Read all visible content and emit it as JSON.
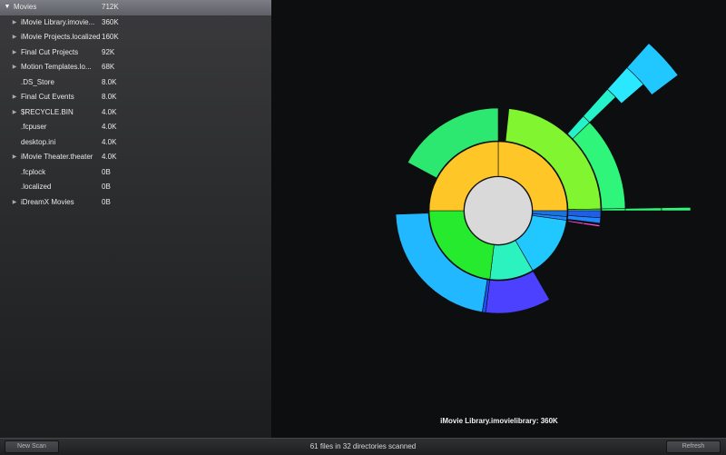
{
  "sidebar": {
    "items": [
      {
        "name": "Movies",
        "size": "712K",
        "expander": "down"
      },
      {
        "name": "iMovie Library.imovie...",
        "size": "360K",
        "expander": "right"
      },
      {
        "name": "iMovie Projects.localized",
        "size": "160K",
        "expander": "right"
      },
      {
        "name": "Final Cut Projects",
        "size": "92K",
        "expander": "right"
      },
      {
        "name": "Motion Templates.lo...",
        "size": "68K",
        "expander": "right"
      },
      {
        "name": ".DS_Store",
        "size": "8.0K",
        "expander": "none"
      },
      {
        "name": "Final Cut Events",
        "size": "8.0K",
        "expander": "right"
      },
      {
        "name": "$RECYCLE.BIN",
        "size": "4.0K",
        "expander": "right"
      },
      {
        "name": ".fcpuser",
        "size": "4.0K",
        "expander": "none"
      },
      {
        "name": "desktop.ini",
        "size": "4.0K",
        "expander": "none"
      },
      {
        "name": "iMovie Theater.theater",
        "size": "4.0K",
        "expander": "right"
      },
      {
        "name": ".fcplock",
        "size": "0B",
        "expander": "none"
      },
      {
        "name": ".localized",
        "size": "0B",
        "expander": "none"
      },
      {
        "name": "iDreamX Movies",
        "size": "0B",
        "expander": "right"
      }
    ]
  },
  "glyphs": {
    "down": "▼",
    "right": "▶",
    "none": ""
  },
  "sunburst": {
    "center_color": "#d9d9d9",
    "segments": [
      {
        "ring": 1,
        "a0": -90,
        "a1": 0,
        "color": "#ffc627"
      },
      {
        "ring": 1,
        "a0": 0,
        "a1": 5,
        "color": "#1a73e0"
      },
      {
        "ring": 1,
        "a0": 5,
        "a1": 8,
        "color": "#1f86ff"
      },
      {
        "ring": 1,
        "a0": 8,
        "a1": 60,
        "color": "#21c8ff"
      },
      {
        "ring": 1,
        "a0": 60,
        "a1": 97,
        "color": "#2cf2c0"
      },
      {
        "ring": 1,
        "a0": 97,
        "a1": 180,
        "color": "#26ea2e"
      },
      {
        "ring": 1,
        "a0": 180,
        "a1": 270,
        "color": "#ffc627"
      },
      {
        "ring": 2,
        "a0": -84,
        "a1": -1,
        "color": "#82f531"
      },
      {
        "ring": 2,
        "a0": -1,
        "a1": 0,
        "color": "#4be56f"
      },
      {
        "ring": 2,
        "a0": 0,
        "a1": 4,
        "color": "#1e5fe6"
      },
      {
        "ring": 2,
        "a0": 4,
        "a1": 7,
        "color": "#1f86ff"
      },
      {
        "ring": 2,
        "a0": 60,
        "a1": 97,
        "color": "#4b41ff"
      },
      {
        "ring": 2,
        "a0": 97,
        "a1": 99,
        "color": "#1c4ff0"
      },
      {
        "ring": 2,
        "a0": 99,
        "a1": 178,
        "color": "#21b8ff"
      },
      {
        "ring": 2,
        "a0": 208,
        "a1": 270,
        "color": "#2ce870"
      },
      {
        "ring": 3,
        "a0": -44,
        "a1": -1,
        "color": "#2ff57a"
      },
      {
        "ring": 3,
        "a0": -1,
        "a1": 0,
        "color": "#2ff57a"
      },
      {
        "ring": 3,
        "a0": -48,
        "a1": -44,
        "color": "#25f2c8"
      },
      {
        "ring": 3,
        "a0": 8,
        "a1": 9,
        "color": "#ff4fe0"
      },
      {
        "ring": 4,
        "a0": -48,
        "a1": -44,
        "color": "#25f2c8"
      },
      {
        "ring": 4,
        "a0": -1,
        "a1": 0,
        "color": "#2ff57a"
      },
      {
        "ring": 4,
        "a0": 8,
        "a1": 9,
        "color": "#ff4fe0"
      },
      {
        "ring": 5,
        "a0": -48,
        "a1": -41,
        "color": "#2ae8ff"
      },
      {
        "ring": 5,
        "a0": -1,
        "a1": 0,
        "color": "#2ff57a"
      },
      {
        "ring": 6,
        "a0": -48,
        "a1": -37,
        "color": "#21c8ff"
      }
    ]
  },
  "viz": {
    "caption": "iMovie Library.imovielibrary: 360K"
  },
  "footer": {
    "new_scan": "New Scan",
    "status": "61 files in 32 directories scanned",
    "refresh": "Refresh"
  }
}
